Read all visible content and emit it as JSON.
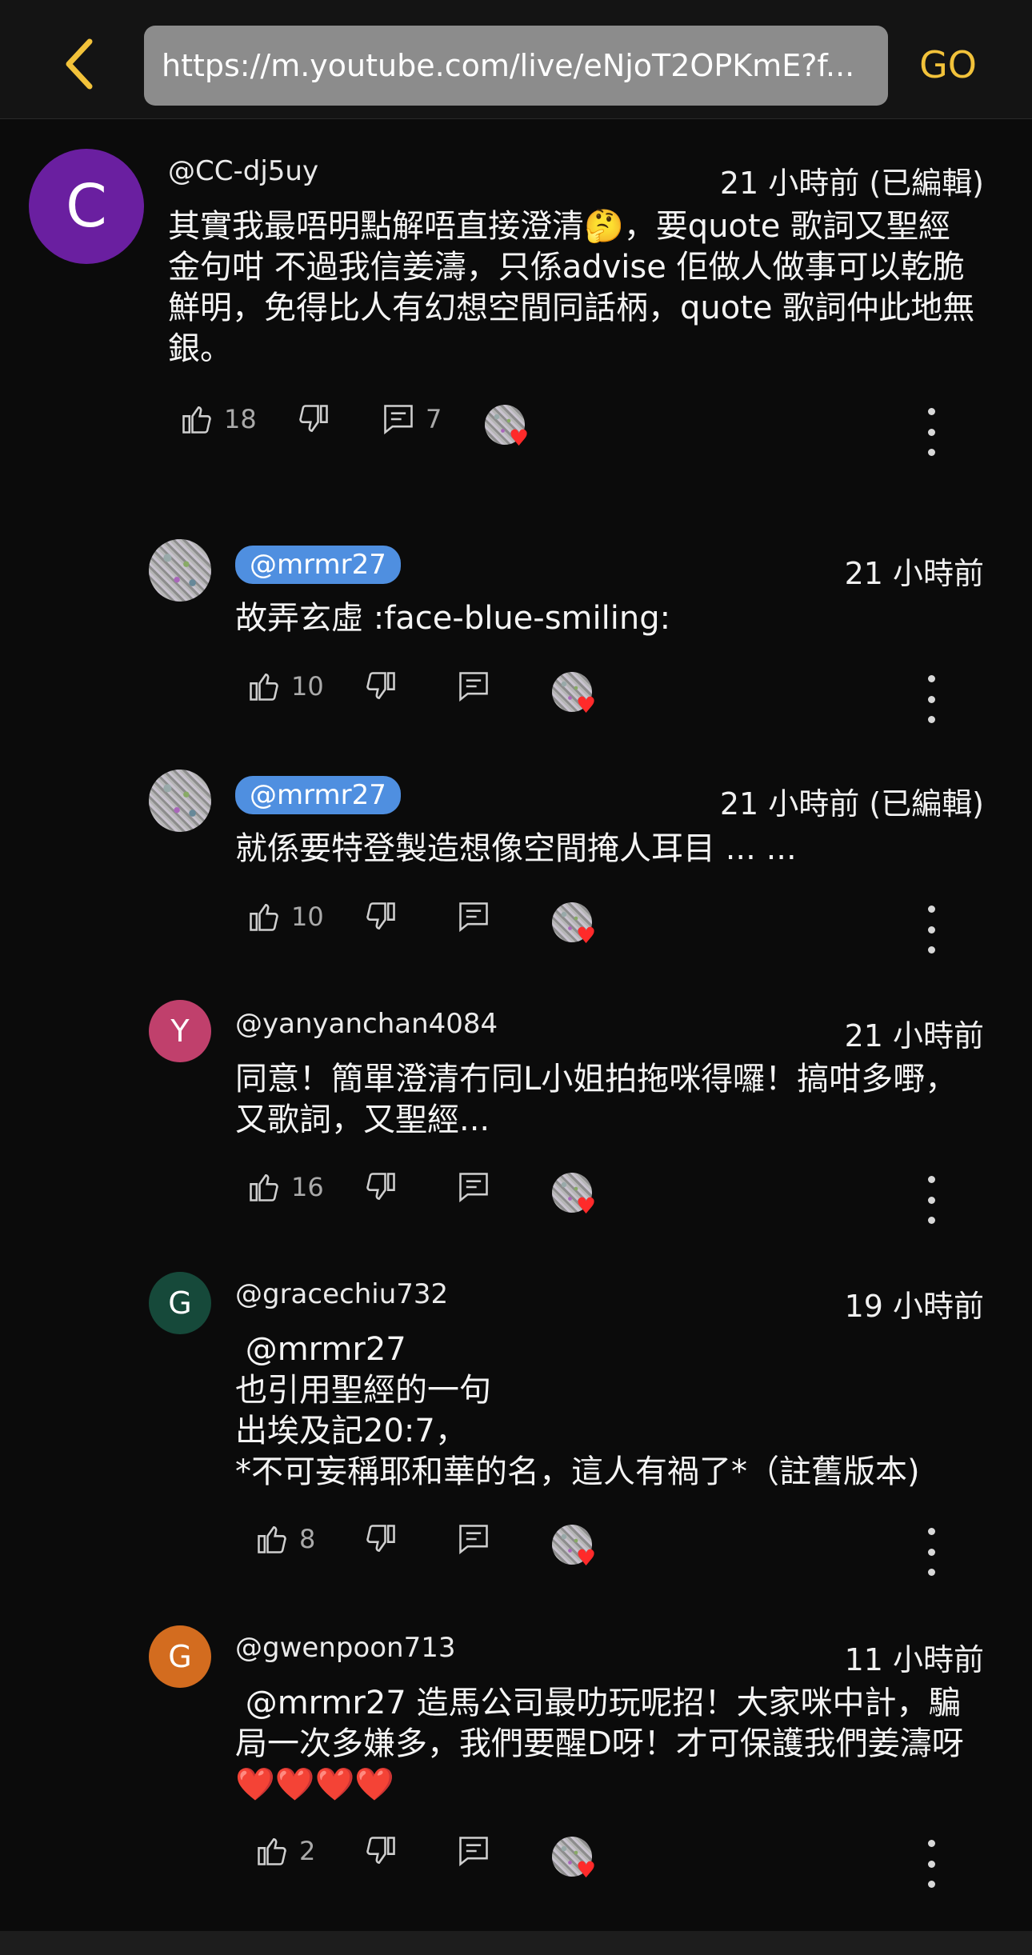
{
  "topbar": {
    "url": "https://m.youtube.com/live/eNjoT2OPKmE?f...",
    "go_label": "GO",
    "accent_color": "#f2c23a"
  },
  "comments": [
    {
      "avatar_letter": "C",
      "avatar_color": "#6a1fa0",
      "username": "@CC-dj5uy",
      "time": "21 小時前 (已編輯)",
      "text": "其實我最唔明點解唔直接澄清🤔，要quote 歌詞又聖經金句咁 不過我信姜濤，只係advise 佢做人做事可以乾脆鮮明，免得比人有幻想空間同話柄，quote 歌詞仲此地無銀。",
      "likes": "18",
      "replies": "7"
    },
    {
      "avatar_letter": "",
      "username": "@mrmr27",
      "time": "21 小時前",
      "text": "故弄玄虛 :face-blue-smiling:",
      "likes": "10"
    },
    {
      "avatar_letter": "",
      "username": "@mrmr27",
      "time": "21 小時前 (已編輯)",
      "text": "就係要特登製造想像空間掩人耳目 ... ...",
      "likes": "10"
    },
    {
      "avatar_letter": "Y",
      "avatar_color": "#c0406c",
      "username": "@yanyanchan4084",
      "time": "21 小時前",
      "text": "同意！簡單澄清冇同L小姐拍拖咪得囉！搞咁多嘢，又歌詞，又聖經...",
      "likes": "16"
    },
    {
      "avatar_letter": "G",
      "avatar_color": "#16493a",
      "username": "@gracechiu732",
      "time": "19 小時前",
      "text": " @mrmr27 \n也引用聖經的一句\n出埃及記20:7，\n*不可妄稱耶和華的名，這人有禍了*（註舊版本)",
      "likes": "8"
    },
    {
      "avatar_letter": "G",
      "avatar_color": "#d36c1f",
      "username": "@gwenpoon713",
      "time": "11 小時前",
      "text": " @mrmr27 造馬公司最叻玩呢招！大家咪中計，騙局一次多嫌多，我們要醒D呀！才可保護我們姜濤呀❤️❤️❤️❤️",
      "likes": "2"
    }
  ]
}
